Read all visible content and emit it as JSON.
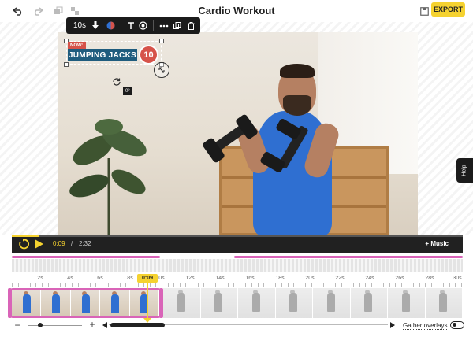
{
  "header": {
    "title": "Cardio Workout",
    "export_label": "EXPORT",
    "icons": [
      "undo-icon",
      "redo-icon",
      "duplicate-icon",
      "ungroup-icon",
      "save-icon"
    ]
  },
  "overlay_toolbar": {
    "duration": "10s",
    "icons": [
      "animation-icon",
      "color-icon",
      "text-icon",
      "style-icon",
      "more-icon",
      "copy-icon",
      "trash-icon"
    ]
  },
  "text_overlay": {
    "tag": "NOW:",
    "label": "JUMPING JACKS",
    "count": "10",
    "rotation": "0°",
    "colors": {
      "tag_bg": "#d6534a",
      "label_bg": "#1f5c7e",
      "count_bg": "#d6534a"
    }
  },
  "help_label": "Help",
  "player": {
    "current_time": "0:09",
    "separator": "/",
    "total_time": "2:32",
    "music_label": "+ Music",
    "progress": 0.059
  },
  "timeline": {
    "ticks": [
      "2s",
      "4s",
      "6s",
      "8s",
      "10s",
      "12s",
      "14s",
      "16s",
      "18s",
      "20s",
      "22s",
      "24s",
      "26s",
      "28s",
      "30s"
    ],
    "playhead_label": "0:09",
    "gather_label": "Gather overlays"
  },
  "colors": {
    "accent": "#f5d230",
    "overlay_track": "#d964b8",
    "player_bg": "#212121"
  }
}
